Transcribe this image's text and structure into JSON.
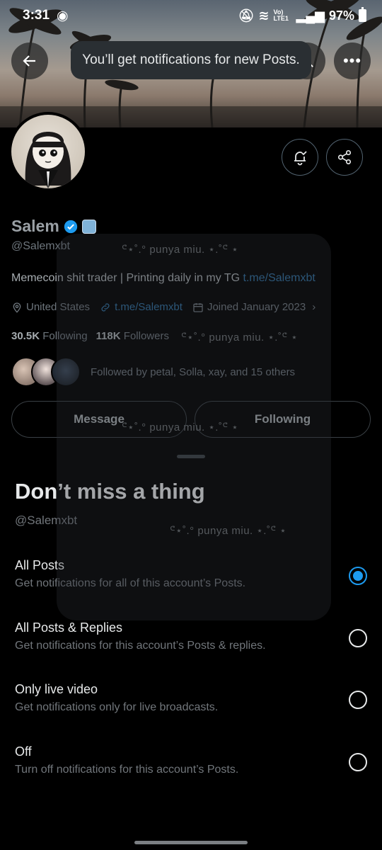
{
  "status_bar": {
    "time": "3:31",
    "network": "Vo) LTE1",
    "battery": "97%"
  },
  "toast": {
    "text": "You’ll get notifications for new Posts."
  },
  "profile": {
    "name": "Salem",
    "handle": "@Salemxbt",
    "bio_text": "Memecoin shit trader | Printing daily in my TG ",
    "bio_link": "t.me/Salemxbt",
    "location": "United States",
    "website": "t.me/Salemxbt",
    "joined": "Joined January 2023",
    "following_count": "30.5K",
    "following_label": "Following",
    "followers_count": "118K",
    "followers_label": "Followers",
    "followed_by": "Followed by petal, Solla, xay, and 15 others",
    "message_label": "Message",
    "following_button_label": "Following"
  },
  "watermarks": [
    "ᕪ⋆˚.°  punya miu.  ⋆.˚ᕪ ⋆",
    "ᕪ⋆˚.°  punya miu.  ⋆.˚ᕪ ⋆",
    "ᕪ⋆˚.°  punya miu.  ⋆.˚ᕪ ⋆",
    "ᕪ⋆˚.°  punya miu.  ⋆.˚ᕪ ⋆"
  ],
  "sheet": {
    "title": "Don’t miss a thing",
    "handle": "@Salemxbt",
    "options": [
      {
        "title": "All Posts",
        "desc": "Get notifications for all of this account’s Posts.",
        "selected": true
      },
      {
        "title": "All Posts & Replies",
        "desc": "Get notifications for this account’s Posts & replies.",
        "selected": false
      },
      {
        "title": "Only live video",
        "desc": "Get notifications only for live broadcasts.",
        "selected": false
      },
      {
        "title": "Off",
        "desc": "Turn off notifications for this account’s Posts.",
        "selected": false
      }
    ]
  },
  "colors": {
    "accent": "#1d9bf0",
    "link": "#1d9bf0",
    "background": "#000000"
  }
}
